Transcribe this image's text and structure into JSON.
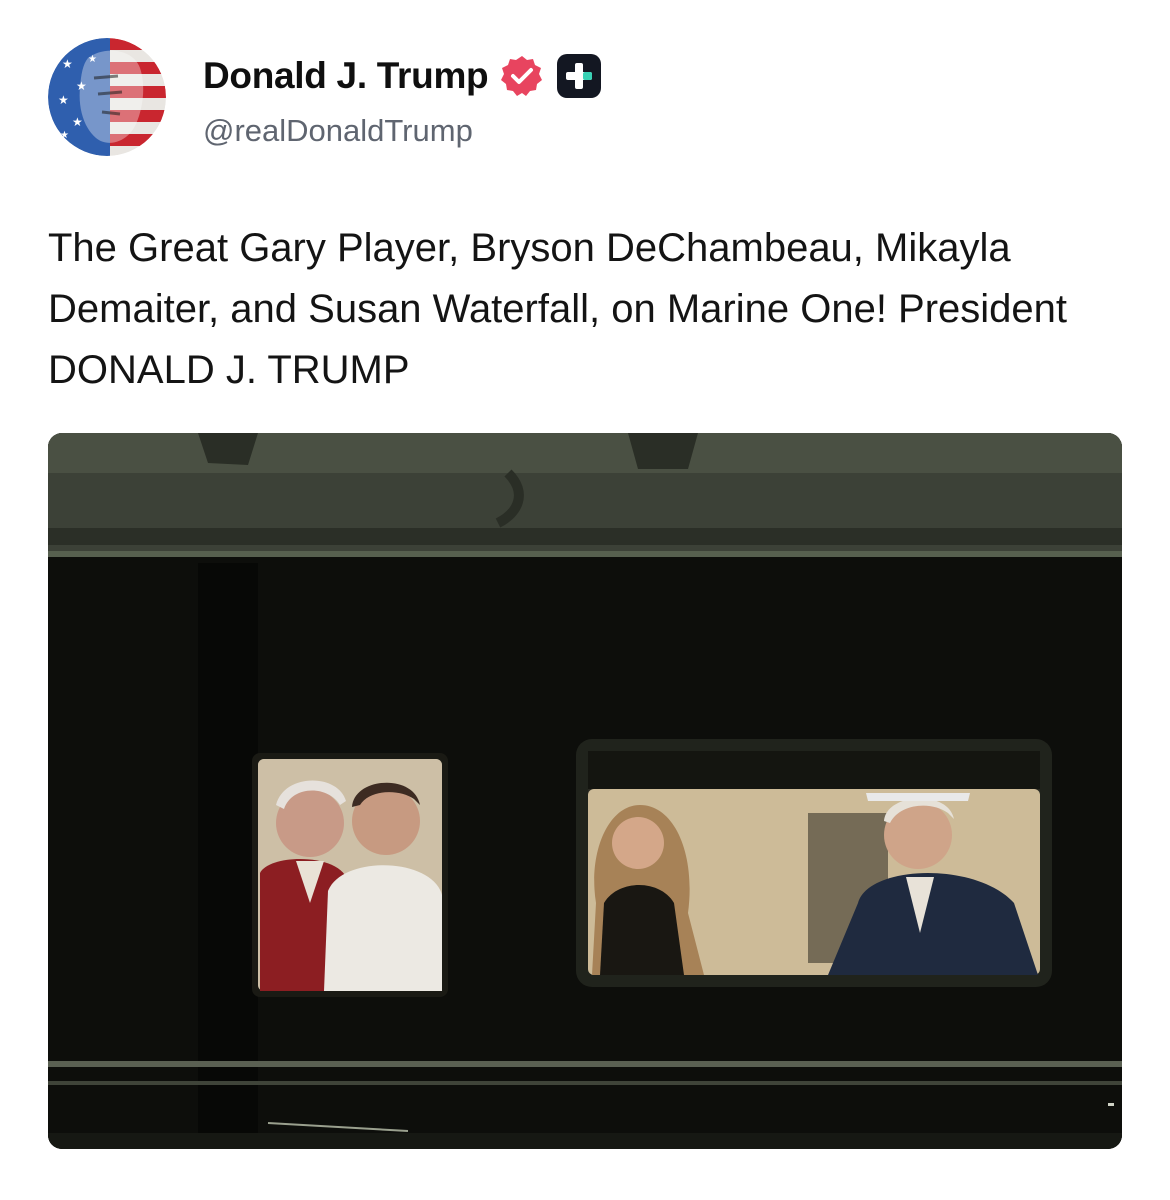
{
  "post": {
    "author": {
      "display_name": "Donald J. Trump",
      "handle": "@realDonaldTrump",
      "verified_icon": "verified-badge-icon",
      "plus_icon": "plus-badge-icon"
    },
    "text": "The Great Gary Player, Bryson DeChambeau, Mikayla Demaiter, and Susan Waterfall, on Marine One! President DONALD J. TRUMP",
    "media": {
      "type": "photo",
      "description_icon": "photo"
    }
  },
  "colors": {
    "verified": "#e8445f",
    "plus_badge_bg": "#131722",
    "plus_badge_accent": "#38d1b5",
    "handle": "#5f6570"
  }
}
